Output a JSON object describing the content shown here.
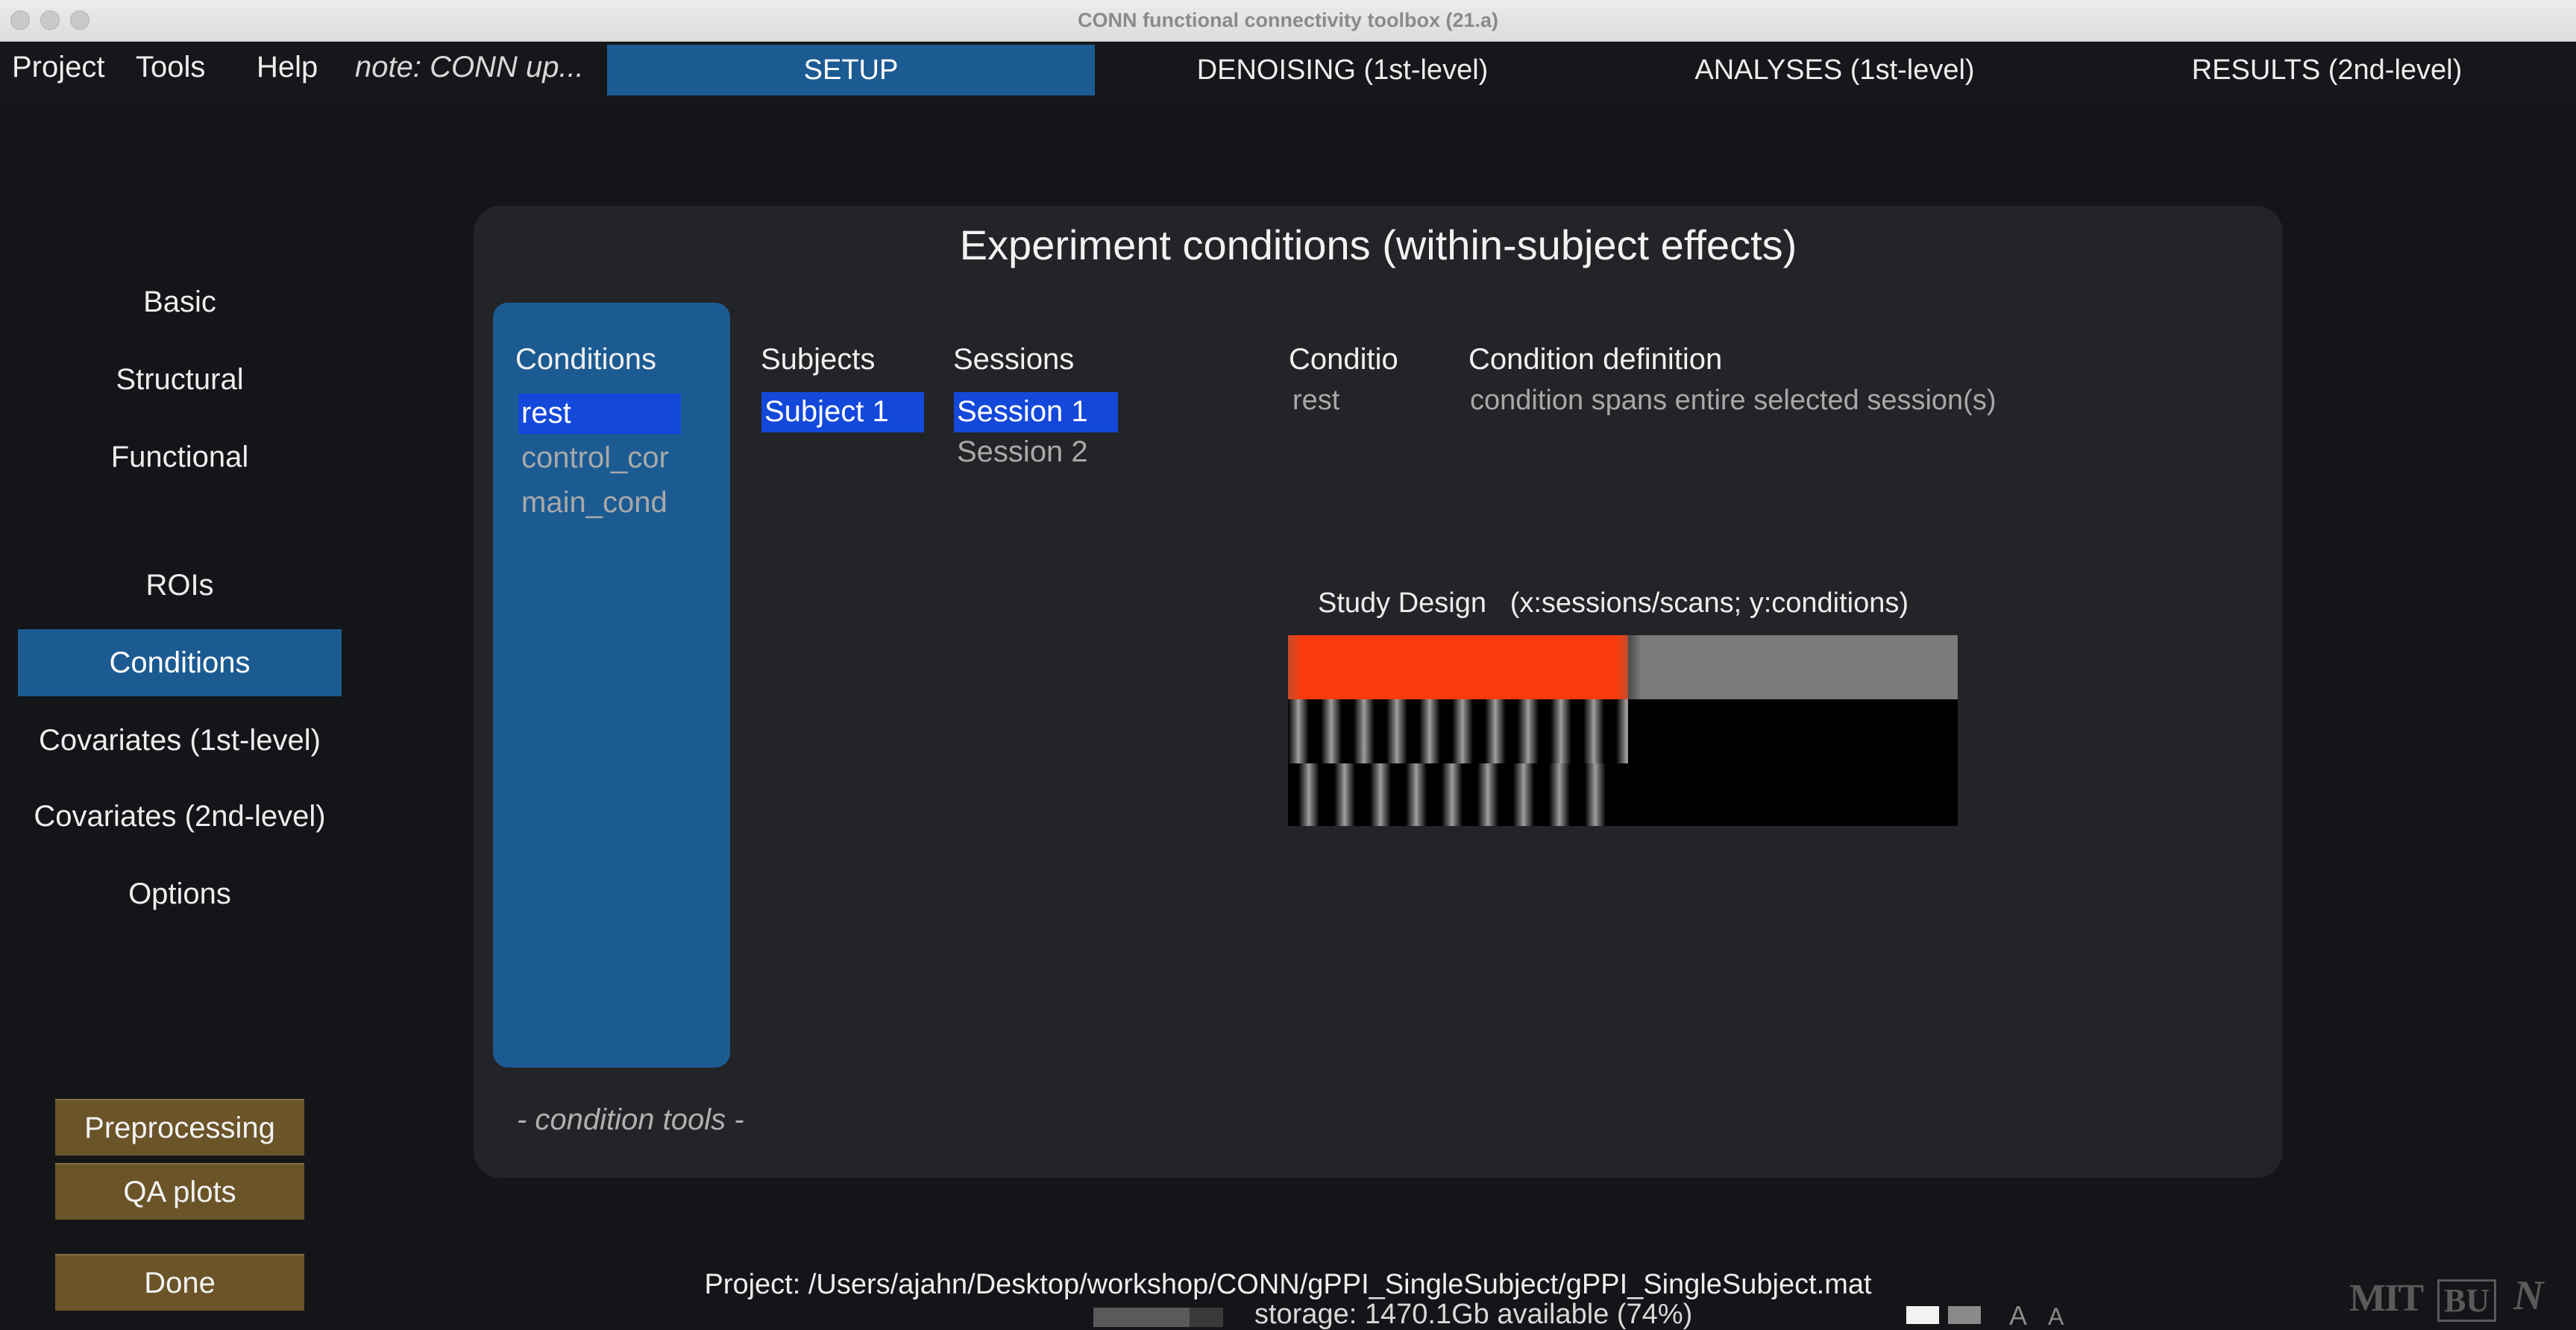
{
  "window": {
    "title": "CONN functional connectivity toolbox (21.a)"
  },
  "menubar": {
    "items": [
      "Project",
      "Tools",
      "Help"
    ],
    "note": "note: CONN up...",
    "tabs": [
      {
        "label": "SETUP",
        "active": true
      },
      {
        "label": "DENOISING (1st-level)",
        "active": false
      },
      {
        "label": "ANALYSES (1st-level)",
        "active": false
      },
      {
        "label": "RESULTS (2nd-level)",
        "active": false
      }
    ]
  },
  "sidebar": {
    "items": [
      {
        "label": "Basic",
        "active": false
      },
      {
        "label": "Structural",
        "active": false
      },
      {
        "label": "Functional",
        "active": false
      },
      {
        "label": "ROIs",
        "active": false
      },
      {
        "label": "Conditions",
        "active": true
      },
      {
        "label": "Covariates (1st-level)",
        "active": false
      },
      {
        "label": "Covariates (2nd-level)",
        "active": false
      },
      {
        "label": "Options",
        "active": false
      }
    ],
    "buttons": {
      "preprocessing": "Preprocessing",
      "qa_plots": "QA plots",
      "done": "Done"
    }
  },
  "panel": {
    "title": "Experiment conditions (within-subject effects)",
    "conditions": {
      "header": "Conditions",
      "items": [
        "rest",
        "control_cor",
        "main_cond"
      ],
      "selected": 0
    },
    "subjects": {
      "header": "Subjects",
      "items": [
        "Subject 1"
      ],
      "selected": 0
    },
    "sessions": {
      "header": "Sessions",
      "items": [
        "Session 1",
        "Session 2"
      ],
      "selected": 0
    },
    "condition_name": {
      "header": "Conditio",
      "value": "rest"
    },
    "condition_definition": {
      "header": "Condition definition",
      "value": "condition spans entire selected session(s)"
    },
    "study_design": {
      "label": "Study Design",
      "axes": "(x:sessions/scans; y:conditions)"
    },
    "tools_label": "- condition tools -"
  },
  "status": {
    "project": "Project: /Users/ajahn/Desktop/workshop/CONN/gPPI_SingleSubject/gPPI_SingleSubject.mat",
    "storage": "storage: 1470.1Gb available (74%)",
    "storage_available_fraction": 0.74,
    "font_size_controls": [
      "A",
      "A"
    ]
  },
  "logos": [
    "MIT",
    "BU",
    "N"
  ],
  "colors": {
    "accent": "#1c5b92",
    "selection": "#1348db",
    "gold_button": "#6a5428",
    "design_active": "#fb3b0d",
    "design_inactive": "#7b7b7b"
  }
}
